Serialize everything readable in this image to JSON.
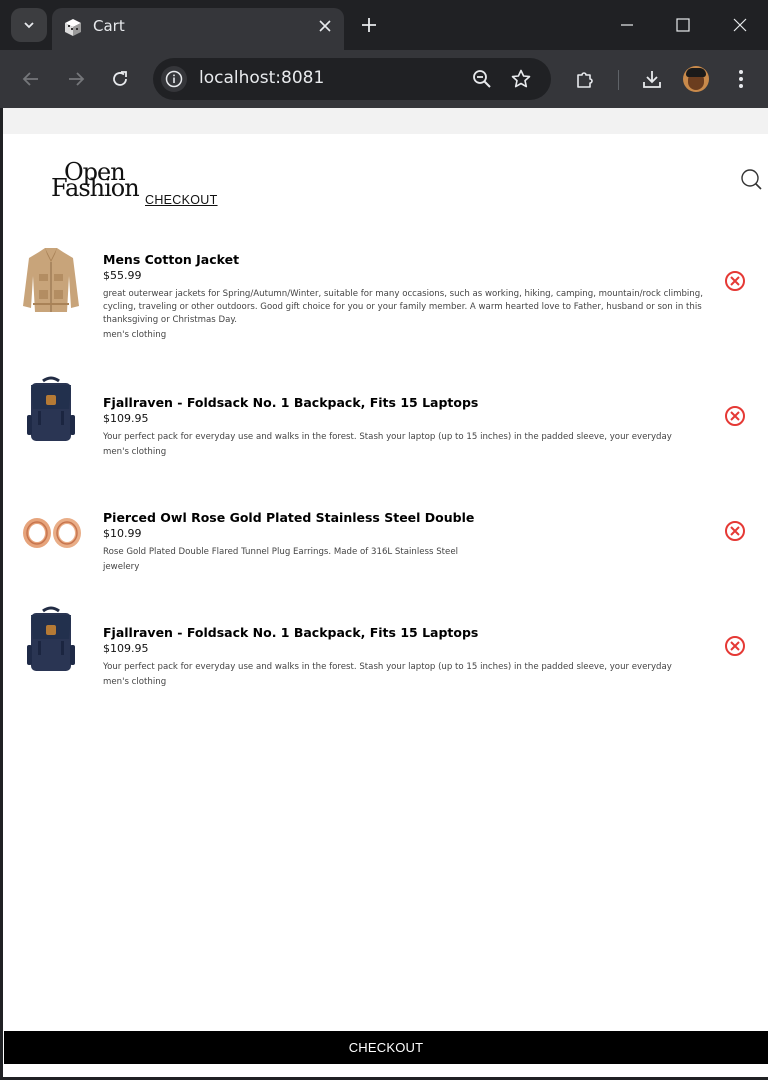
{
  "browser": {
    "tab_title": "Cart",
    "url": "localhost:8081"
  },
  "page": {
    "logo_line1": "Open",
    "logo_line2": "Fashion",
    "heading": "CHECKOUT",
    "checkout_button": "CHECKOUT"
  },
  "cart": {
    "items": [
      {
        "title": "Mens Cotton Jacket",
        "price": "$55.99",
        "description": "great outerwear jackets for Spring/Autumn/Winter, suitable for many occasions, such as working, hiking, camping, mountain/rock climbing, cycling, traveling or other outdoors. Good gift choice for you or your family member. A warm hearted love to Father, husband or son in this thanksgiving or Christmas Day.",
        "category": "men's clothing",
        "image": "jacket"
      },
      {
        "title": "Fjallraven - Foldsack No. 1 Backpack, Fits 15 Laptops",
        "price": "$109.95",
        "description": "Your perfect pack for everyday use and walks in the forest. Stash your laptop (up to 15 inches) in the padded sleeve, your everyday",
        "category": "men's clothing",
        "image": "backpack"
      },
      {
        "title": "Pierced Owl Rose Gold Plated Stainless Steel Double",
        "price": "$10.99",
        "description": "Rose Gold Plated Double Flared Tunnel Plug Earrings. Made of 316L Stainless Steel",
        "category": "jewelery",
        "image": "earrings"
      },
      {
        "title": "Fjallraven - Foldsack No. 1 Backpack, Fits 15 Laptops",
        "price": "$109.95",
        "description": "Your perfect pack for everyday use and walks in the forest. Stash your laptop (up to 15 inches) in the padded sleeve, your everyday",
        "category": "men's clothing",
        "image": "backpack"
      }
    ]
  },
  "colors": {
    "remove_icon": "#e53935",
    "checkout_bg": "#000000",
    "chrome_bg": "#202124",
    "toolbar_bg": "#35363a"
  }
}
